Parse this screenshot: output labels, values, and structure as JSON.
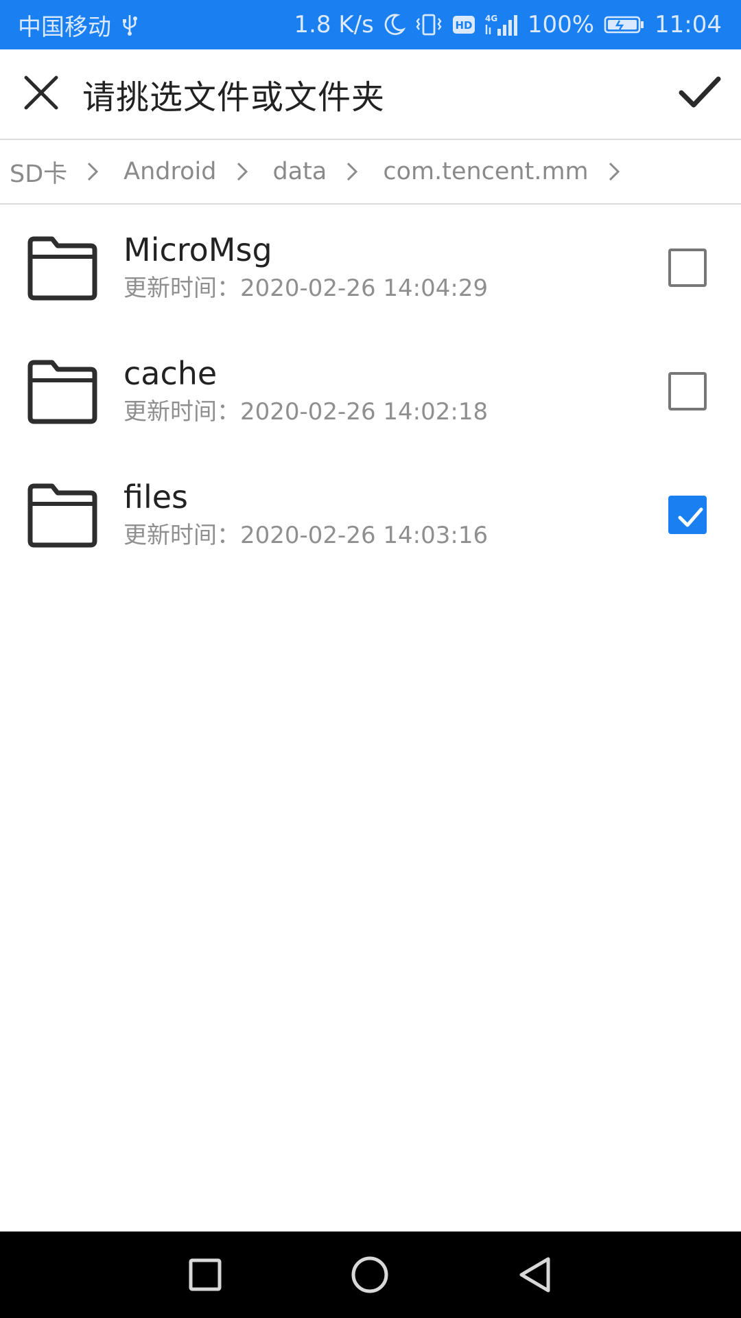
{
  "status_bar": {
    "carrier": "中国移动",
    "net_speed": "1.8 K/s",
    "hd_badge": "HD",
    "network_type": "4G",
    "battery": "100%",
    "time": "11:04",
    "icons": [
      "usb-icon",
      "moon-icon",
      "vibrate-icon",
      "hd-icon",
      "signal-icon",
      "battery-charging-icon"
    ]
  },
  "title_bar": {
    "title": "请挑选文件或文件夹",
    "icons": [
      "close-icon",
      "check-icon"
    ]
  },
  "breadcrumb": {
    "items": [
      "SD卡",
      "Android",
      "data",
      "com.tencent.mm"
    ],
    "separator_icon": "chevron-right-icon"
  },
  "files": [
    {
      "name": "MicroMsg",
      "meta": "更新时间：2020-02-26 14:04:29",
      "checked": false,
      "icon": "folder-icon"
    },
    {
      "name": "cache",
      "meta": "更新时间：2020-02-26 14:02:18",
      "checked": false,
      "icon": "folder-icon"
    },
    {
      "name": "files",
      "meta": "更新时间：2020-02-26 14:03:16",
      "checked": true,
      "icon": "folder-icon"
    }
  ],
  "nav_bar": {
    "icons": [
      "recents-square-icon",
      "home-circle-icon",
      "back-triangle-icon"
    ]
  },
  "colors": {
    "accent": "#1a7ff0",
    "status_text": "#dbe9ff",
    "meta_text": "#8f8f8f",
    "nav_background": "#000000"
  }
}
